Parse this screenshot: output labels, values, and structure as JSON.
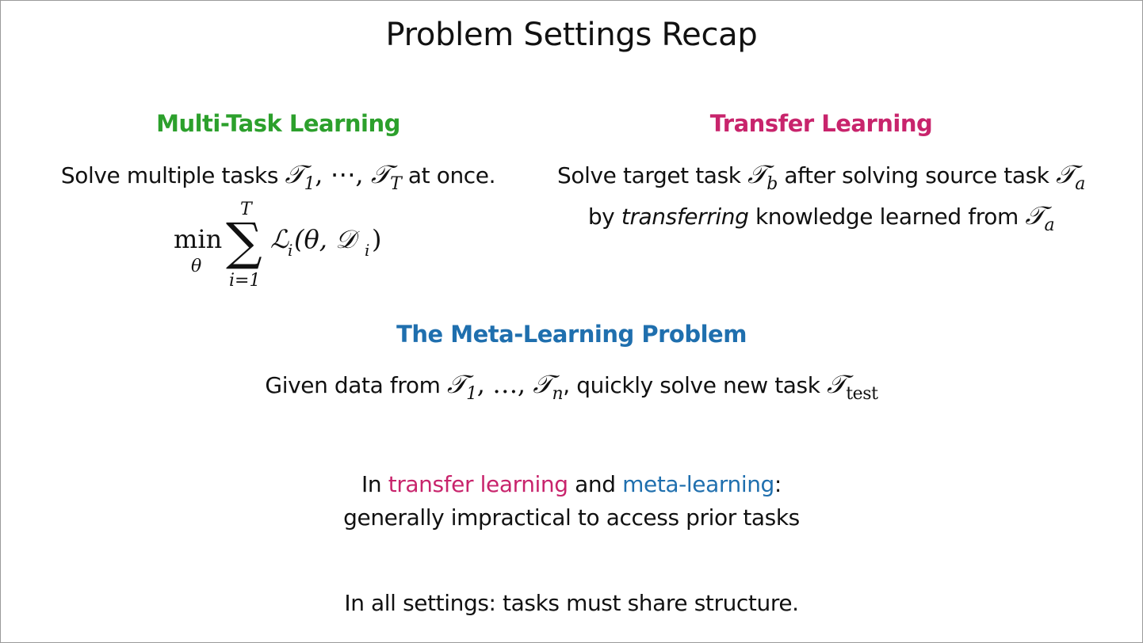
{
  "slide": {
    "title": "Problem Settings Recap",
    "multi_task": {
      "heading": "Multi-Task Learning",
      "line_prefix": "Solve multiple tasks ",
      "line_math": "𝒯",
      "sub1": "1",
      "sep": ", ⋯, ",
      "subT": "T",
      "line_suffix": " at once.",
      "formula": {
        "op": "min",
        "op_sub": "θ",
        "sum": "∑",
        "sum_upper": "T",
        "sum_lower": "i=1",
        "body": "ℒ",
        "body_sub": "i",
        "args": "(θ, 𝒟",
        "args_sub": "i",
        "close": ")"
      }
    },
    "transfer": {
      "heading": "Transfer Learning",
      "line1_prefix": "Solve target task ",
      "sym": "𝒯",
      "sub_b": "b",
      "line1_mid": " after solving source task ",
      "sub_a": "a",
      "line2_prefix": "by ",
      "line2_em": "transferring",
      "line2_mid": " knowledge learned from "
    },
    "meta": {
      "heading": "The Meta-Learning Problem",
      "prefix": "Given data from ",
      "sym": "𝒯",
      "sub1": "1",
      "sep": ", …, ",
      "subn": "n",
      "mid": ", quickly solve new task ",
      "subtest": "test"
    },
    "note1": {
      "prefix": "In ",
      "tl": "transfer learning",
      "and": " and ",
      "ml": "meta-learning",
      "colon": ":",
      "line2": "generally impractical to access prior tasks"
    },
    "note2": "In all settings: tasks must share structure.",
    "colors": {
      "multi_task": "#2ca02c",
      "transfer": "#c8246c",
      "meta": "#1f6fae"
    }
  }
}
